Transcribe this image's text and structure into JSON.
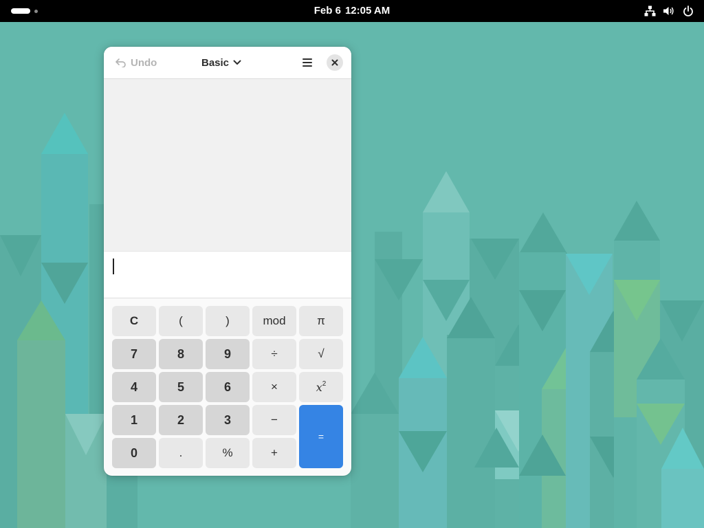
{
  "top_bar": {
    "date": "Feb 6",
    "time": "12:05 AM",
    "tray": [
      "network-icon",
      "volume-icon",
      "power-icon"
    ]
  },
  "calculator": {
    "header": {
      "undo_label": "Undo",
      "mode_label": "Basic"
    },
    "entry_value": "",
    "keys": {
      "clear": "C",
      "open_paren": "(",
      "close_paren": ")",
      "mod": "mod",
      "pi": "π",
      "seven": "7",
      "eight": "8",
      "nine": "9",
      "divide": "÷",
      "sqrt": "√",
      "four": "4",
      "five": "5",
      "six": "6",
      "multiply": "×",
      "square_base": "x",
      "square_exp": "2",
      "one": "1",
      "two": "2",
      "three": "3",
      "subtract": "−",
      "equals": "=",
      "zero": "0",
      "decimal": ".",
      "percent": "%",
      "add": "+"
    }
  },
  "colors": {
    "wallpaper": "#63b8ac",
    "accent": "#3584e4",
    "topbar": "#000000"
  }
}
